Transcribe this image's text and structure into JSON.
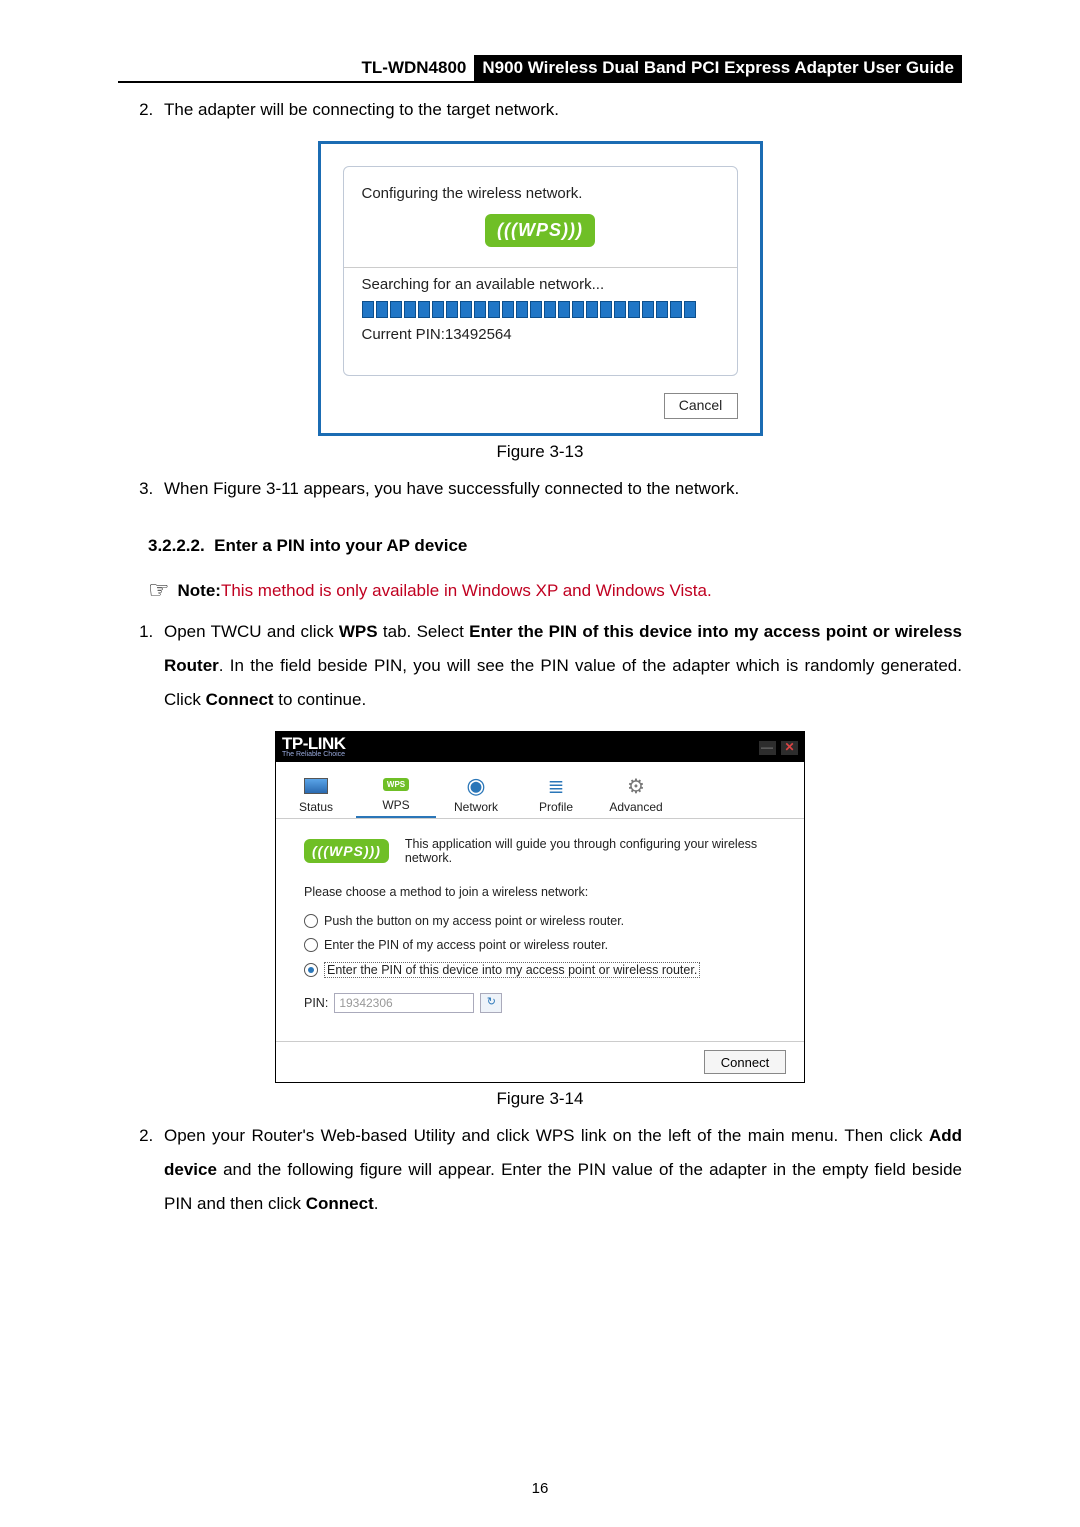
{
  "header": {
    "model": "TL-WDN4800",
    "title": "N900 Wireless Dual Band PCI Express Adapter User Guide"
  },
  "step2_text": "The adapter will be connecting to the target network.",
  "fig13": {
    "line1": "Configuring the wireless network.",
    "wps_label": "(((WPS)))",
    "line2": "Searching for an available network...",
    "pin_line": "Current PIN:13492564",
    "cancel": "Cancel",
    "caption": "Figure 3-13"
  },
  "step3_text": "When Figure 3-11 appears, you have successfully connected to the network.",
  "section": {
    "num": "3.2.2.2.",
    "title": "Enter a PIN into your AP device"
  },
  "note": {
    "label": "Note:",
    "text": " This method is only available in Windows XP and Windows Vista."
  },
  "instr1": {
    "pre": "Open TWCU and click ",
    "b1": "WPS",
    "mid1": " tab. Select ",
    "b2": "Enter the PIN of this device into my access point or wireless Router",
    "mid2": ". In the field beside PIN, you will see the PIN value of the adapter which is randomly generated. Click ",
    "b3": "Connect",
    "post": " to continue."
  },
  "fig14": {
    "logo": "TP-LINK",
    "logo_sub": "The Reliable Choice",
    "tabs": {
      "status": "Status",
      "wps": "WPS",
      "network": "Network",
      "profile": "Profile",
      "advanced": "Advanced",
      "wps_badge": "WPS"
    },
    "intro": "This application will guide you through configuring your wireless network.",
    "choose": "Please choose a method to join a wireless network:",
    "opt1": "Push the button on my access point or wireless router.",
    "opt2": "Enter the PIN of my access point or wireless router.",
    "opt3": "Enter the PIN of this device into my access point or wireless router.",
    "pin_label": "PIN:",
    "pin_value": "19342306",
    "connect": "Connect",
    "caption": "Figure 3-14"
  },
  "instr2": {
    "pre": "Open your Router's Web-based Utility and click WPS link on the left of the main menu. Then click ",
    "b1": "Add device",
    "mid": " and the following figure will appear. Enter the PIN value of the adapter in the empty field beside PIN and then click ",
    "b2": "Connect",
    "post": "."
  },
  "page_num": "16"
}
